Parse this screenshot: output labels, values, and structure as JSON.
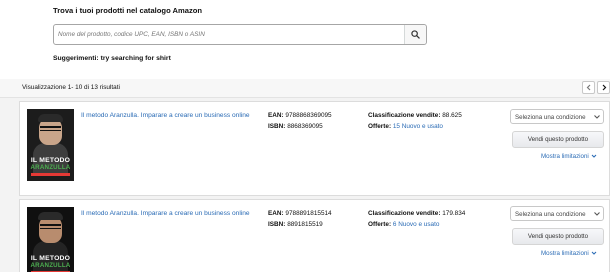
{
  "catalog": {
    "title": "Trova i tuoi prodotti nel catalogo Amazon",
    "search_placeholder": "Nome del prodotto, codice UPC, EAN, ISBN o ASIN",
    "search_value": "",
    "search_icon": "search-icon",
    "suggestions": "Suggerimenti: try searching for shirt"
  },
  "results": {
    "summary": "Visualizzazione 1- 10 di 13 risultati",
    "prev_icon": "chevron-left-icon",
    "next_icon": "chevron-right-icon"
  },
  "labels": {
    "ean": "EAN:",
    "isbn": "ISBN:",
    "rank": "Classificazione vendite:",
    "offers": "Offerte:",
    "condition": "Seleziona una condizione",
    "sell": "Vendi questo prodotto",
    "limits": "Mostra limitazioni"
  },
  "products": [
    {
      "title": "Il metodo Aranzulla. Imparare a creare un business online",
      "ean": "9788868369095",
      "isbn": "8868369095",
      "rank": "88.625",
      "offers": "15 Nuovo e usato",
      "cover_title": "IL METODO",
      "cover_subtitle": "ARANZULLA"
    },
    {
      "title": "Il metodo Aranzulla. Imparare a creare un business online",
      "ean": "9788891815514",
      "isbn": "8891815519",
      "rank": "179.834",
      "offers": "6 Nuovo e usato",
      "cover_title": "IL METODO",
      "cover_subtitle": "ARANZULLA"
    }
  ],
  "colors": {
    "link": "#2a6bb5",
    "band": "#f3f3f3",
    "accent_green": "#4caf50"
  }
}
